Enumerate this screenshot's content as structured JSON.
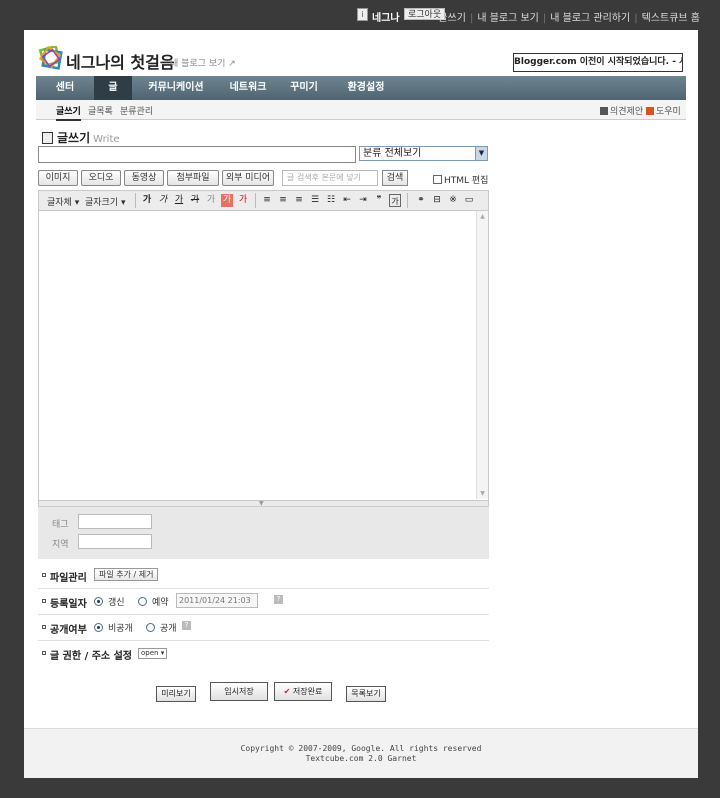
{
  "topbar": {
    "username": "네그나",
    "logout_label": "로그아웃",
    "links": [
      "글쓰기",
      "내 블로그 보기",
      "내 블로그 관리하기",
      "텍스트큐브 홈"
    ]
  },
  "header": {
    "blog_title": "네그나의 첫걸음",
    "view_blog_label": "내 블로그 보기",
    "notice_label": "Blogger.com 이전이 시작되었습니다. - 시작하기 -"
  },
  "main_nav": {
    "items": [
      "센터",
      "글",
      "커뮤니케이션",
      "네트워크",
      "꾸미기",
      "환경설정"
    ],
    "active": "글"
  },
  "sub_nav": {
    "items": [
      "글쓰기",
      "글목록",
      "분류관리"
    ],
    "active": "글쓰기",
    "feedback_label": "의견제안",
    "help_label": "도우미"
  },
  "editor": {
    "heading": "글쓰기",
    "heading_sub": "Write",
    "title_value": "",
    "category_selected": "분류 전체보기",
    "media_buttons": [
      "이미지",
      "오디오",
      "동영상",
      "첨부파일",
      "외부 미디어"
    ],
    "search_placeholder": "글 검색후 본문에 넣기",
    "search_button": "검색",
    "html_edit_label": "HTML 편집",
    "toolbar": {
      "font_label": "글자체",
      "size_label": "글자크기",
      "format_buttons": [
        "가",
        "가",
        "가",
        "가",
        "가",
        "가",
        "가"
      ]
    },
    "tag_label": "태그",
    "location_label": "지역"
  },
  "options": {
    "file_manage": {
      "label": "파일관리",
      "button": "파일 추가 / 제거"
    },
    "register_date": {
      "label": "등록일자",
      "opt_update": "갱신",
      "opt_reserve": "예약",
      "date_value": "2011/01/24 21:03"
    },
    "visibility": {
      "label": "공개여부",
      "opt_private": "비공개",
      "opt_public": "공개"
    },
    "permission": {
      "label": "글 권한 / 주소 설정",
      "select_value": "open"
    }
  },
  "actions": {
    "preview": "미리보기",
    "temp_save": "임시저장",
    "save_done": "저장완료",
    "list_view": "목록보기"
  },
  "footer": {
    "copyright": "Copyright © 2007-2009, Google. All rights reserved",
    "version": "Textcube.com 2.0 Garnet"
  },
  "colors": {
    "nav_bg": "#5b717d",
    "nav_active": "#2f3e46",
    "page_bg": "#3a3a3a",
    "save_check": "#c0272d"
  }
}
